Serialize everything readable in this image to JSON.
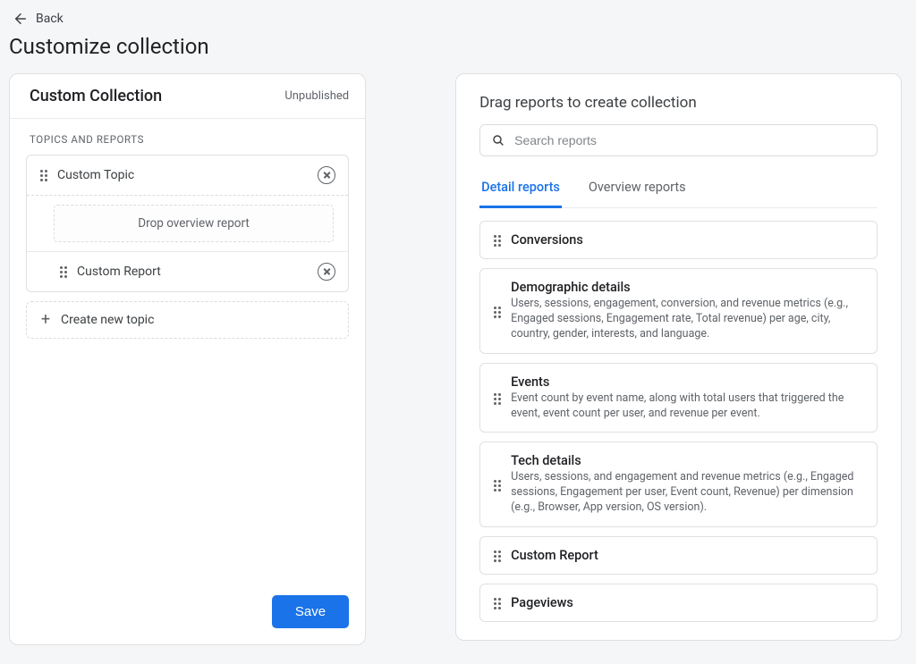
{
  "nav": {
    "back_label": "Back",
    "page_title": "Customize collection"
  },
  "left": {
    "collection_name": "Custom Collection",
    "status": "Unpublished",
    "section_label": "Topics and reports",
    "topic": {
      "name": "Custom Topic",
      "dropzone_text": "Drop overview report",
      "reports": [
        {
          "name": "Custom Report"
        }
      ]
    },
    "create_topic_label": "Create new topic",
    "save_label": "Save"
  },
  "right": {
    "title": "Drag reports to create collection",
    "search_placeholder": "Search reports",
    "tabs": {
      "detail": "Detail reports",
      "overview": "Overview reports"
    },
    "reports": [
      {
        "title": "Conversions",
        "desc": ""
      },
      {
        "title": "Demographic details",
        "desc": "Users, sessions, engagement, conversion, and revenue metrics (e.g., Engaged sessions, Engagement rate, Total revenue) per age, city, country, gender, interests, and language."
      },
      {
        "title": "Events",
        "desc": "Event count by event name, along with total users that triggered the event, event count per user, and revenue per event."
      },
      {
        "title": "Tech details",
        "desc": "Users, sessions, and engagement and revenue metrics (e.g., Engaged sessions, Engagement per user, Event count, Revenue) per dimension (e.g., Browser, App version, OS version)."
      },
      {
        "title": "Custom Report",
        "desc": ""
      },
      {
        "title": "Pageviews",
        "desc": ""
      }
    ]
  }
}
